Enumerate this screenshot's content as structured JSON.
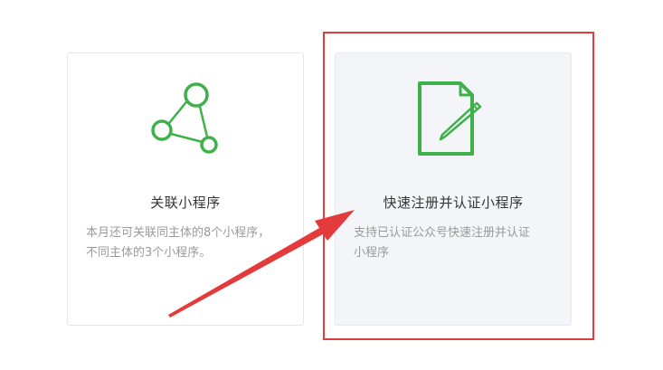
{
  "cards": [
    {
      "title": "关联小程序",
      "desc_line1": "本月还可关联同主体的8个小程序，",
      "desc_line2": "不同主体的3个小程序。",
      "icon": "share-nodes-icon"
    },
    {
      "title": "快速注册并认证小程序",
      "desc_line1": "支持已认证公众号快速注册并认证",
      "desc_line2": "小程序",
      "icon": "document-edit-icon"
    }
  ],
  "colors": {
    "icon_green": "#3fb14a",
    "annotation_red": "#e33b3b",
    "card_border": "#e6e6e6",
    "selected_card_bg": "#f4f5f9",
    "title_text": "#353535",
    "desc_text": "#9a9a9a"
  }
}
